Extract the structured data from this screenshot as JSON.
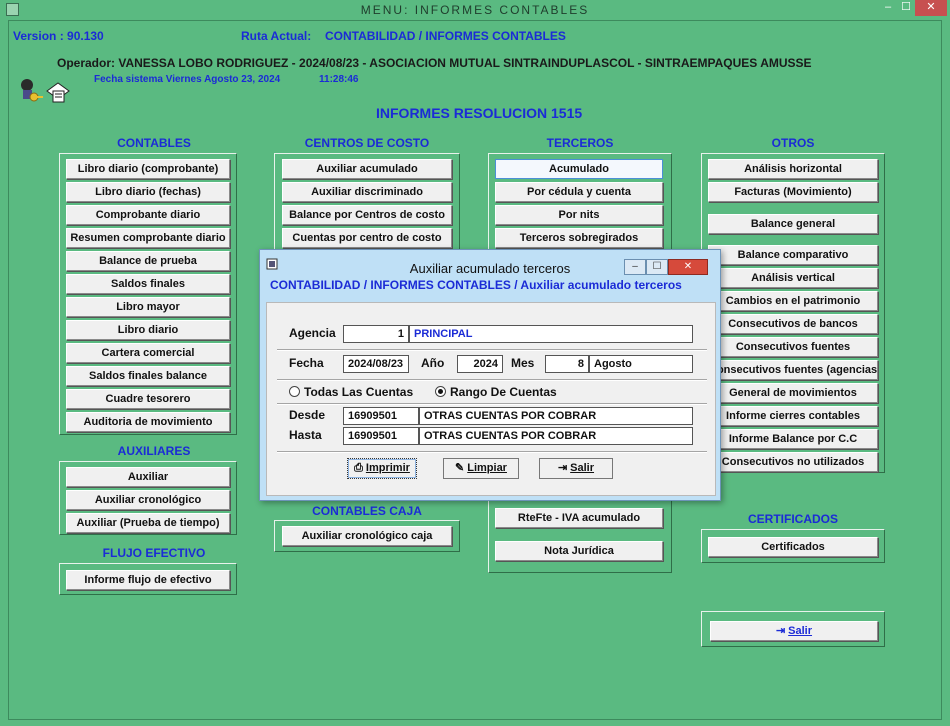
{
  "window": {
    "title": "MENU: INFORMES CONTABLES",
    "min": "–",
    "max": "☐",
    "close": "✕"
  },
  "header": {
    "version": "Version : 90.130",
    "ruta_label": "Ruta Actual:",
    "ruta_value": "CONTABILIDAD / INFORMES CONTABLES",
    "operador": "Operador: VANESSA LOBO RODRIGUEZ - 2024/08/23 - ASOCIACION MUTUAL SINTRAINDUPLASCOL - SINTRAEMPAQUES AMUSSE",
    "fecha_sistema": "Fecha sistema Viernes Agosto 23, 2024",
    "hora": "11:28:46",
    "main_title": "INFORMES RESOLUCION 1515"
  },
  "sections": {
    "contables": {
      "title": "CONTABLES",
      "items": [
        "Libro diario (comprobante)",
        "Libro diario (fechas)",
        "Comprobante diario",
        "Resumen comprobante diario",
        "Balance de prueba",
        "Saldos finales",
        "Libro mayor",
        "Libro diario",
        "Cartera comercial",
        "Saldos finales balance",
        "Cuadre tesorero",
        "Auditoria de movimiento"
      ]
    },
    "auxiliares": {
      "title": "AUXILIARES",
      "items": [
        "Auxiliar",
        "Auxiliar cronológico",
        "Auxiliar (Prueba de tiempo)"
      ]
    },
    "flujo": {
      "title": "FLUJO EFECTIVO",
      "items": [
        "Informe flujo de efectivo"
      ]
    },
    "centros": {
      "title": "CENTROS DE COSTO",
      "items": [
        "Auxiliar acumulado",
        "Auxiliar discriminado",
        "Balance por Centros de costo",
        "Cuentas por centro de costo"
      ]
    },
    "caja": {
      "title": "CONTABLES CAJA",
      "items": [
        "Auxiliar cronológico caja"
      ]
    },
    "terceros": {
      "title": "TERCEROS",
      "items": [
        "Acumulado",
        "Por cédula y cuenta",
        "Por nits",
        "Terceros sobregirados"
      ],
      "extra": [
        "RteFte - IVA  acumulado",
        "Nota Jurídica"
      ]
    },
    "otros": {
      "title": "OTROS",
      "items": [
        "Análisis horizontal",
        "Facturas (Movimiento)",
        "Balance general",
        "Balance comparativo",
        "Análisis vertical",
        "Cambios en el patrimonio",
        "Consecutivos de bancos",
        "Consecutivos fuentes",
        "Consecutivos fuentes (agencias)",
        "General de movimientos",
        "Informe cierres contables",
        "Informe Balance por C.C",
        "Consecutivos no utilizados"
      ]
    },
    "certificados": {
      "title": "CERTIFICADOS",
      "items": [
        "Certificados"
      ]
    }
  },
  "salir_main": "Salir",
  "dialog": {
    "title": "Auxiliar acumulado terceros",
    "path": "CONTABILIDAD /  INFORMES  CONTABLES / Auxiliar acumulado terceros",
    "agencia_label": "Agencia",
    "agencia_code": "1",
    "agencia_name": "PRINCIPAL",
    "fecha_label": "Fecha",
    "fecha_value": "2024/08/23",
    "anio_label": "Año",
    "anio_value": "2024",
    "mes_label": "Mes",
    "mes_num": "8",
    "mes_name": "Agosto",
    "radio_todas": "Todas Las  Cuentas",
    "radio_rango": "Rango De Cuentas",
    "desde_label": "Desde",
    "desde_code": "16909501",
    "desde_name": "OTRAS CUENTAS POR COBRAR",
    "hasta_label": "Hasta",
    "hasta_code": "16909501",
    "hasta_name": "OTRAS CUENTAS POR COBRAR",
    "btn_imprimir": "Imprimir",
    "btn_limpiar": "Limpiar",
    "btn_salir": "Salir"
  }
}
